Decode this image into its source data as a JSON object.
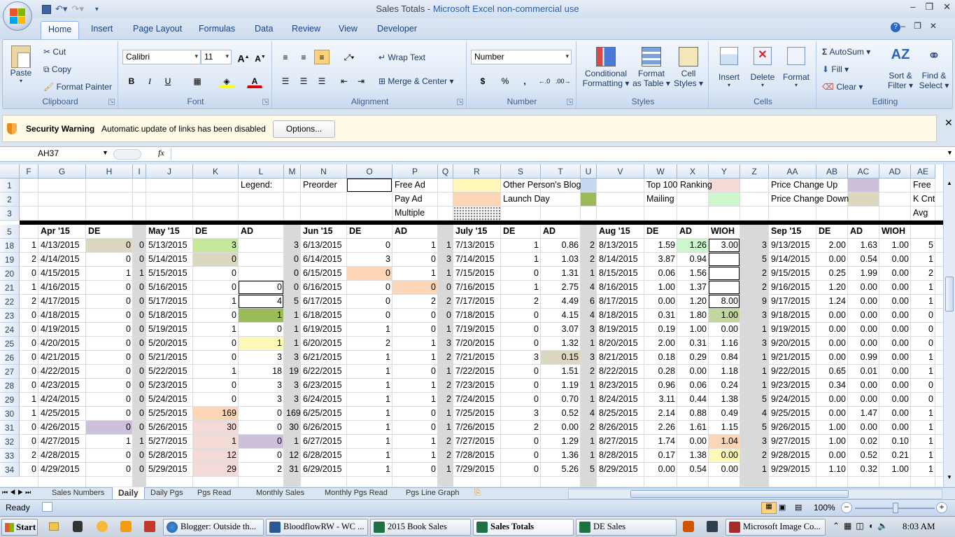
{
  "window": {
    "title_doc": "Sales Totals",
    "title_sep": "  -  ",
    "title_app": "Microsoft Excel non-commercial use"
  },
  "ribbon": {
    "tabs": [
      "Home",
      "Insert",
      "Page Layout",
      "Formulas",
      "Data",
      "Review",
      "View",
      "Developer"
    ],
    "clipboard": {
      "paste": "Paste",
      "cut": "Cut",
      "copy": "Copy",
      "format_painter": "Format Painter",
      "label": "Clipboard"
    },
    "font": {
      "name": "Calibri",
      "size": "11",
      "label": "Font",
      "bold": "B",
      "italic": "I",
      "underline": "U"
    },
    "alignment": {
      "wrap": "Wrap Text",
      "merge": "Merge & Center",
      "label": "Alignment"
    },
    "number": {
      "format": "Number",
      "label": "Number",
      "currency": "$",
      "percent": "%",
      "comma": ","
    },
    "styles": {
      "conditional": "Conditional",
      "conditional2": "Formatting",
      "format_table": "Format",
      "format_table2": "as Table",
      "cell_styles": "Cell",
      "cell_styles2": "Styles",
      "label": "Styles"
    },
    "cells": {
      "insert": "Insert",
      "delete": "Delete",
      "format": "Format",
      "label": "Cells"
    },
    "editing": {
      "autosum": "AutoSum",
      "fill": "Fill",
      "clear": "Clear",
      "sort": "Sort &",
      "sort2": "Filter",
      "find": "Find &",
      "find2": "Select",
      "label": "Editing"
    }
  },
  "security": {
    "title": "Security Warning",
    "message": "Automatic update of links has been disabled",
    "options": "Options..."
  },
  "formula_bar": {
    "name_box": "AH37",
    "fx": "fx",
    "formula": ""
  },
  "columns": [
    "F",
    "G",
    "H",
    "I",
    "J",
    "K",
    "L",
    "M",
    "N",
    "O",
    "P",
    "Q",
    "R",
    "S",
    "T",
    "U",
    "V",
    "W",
    "X",
    "Y",
    "Z",
    "AA",
    "AB",
    "AC",
    "AD",
    "AE"
  ],
  "rows": [
    "1",
    "2",
    "3",
    "5",
    "18",
    "19",
    "20",
    "21",
    "22",
    "23",
    "24",
    "25",
    "26",
    "27",
    "28",
    "29",
    "30",
    "31",
    "32",
    "33",
    "34"
  ],
  "legend": {
    "legend": "Legend:",
    "preorder": "Preorder",
    "free_ad": "Free Ad",
    "pay_ad": "Pay Ad",
    "multiple": "Multiple",
    "other_blog": "Other Person's Blog",
    "launch_day": "Launch Day",
    "top100": "Top 100 Ranking",
    "mailing": "Mailing",
    "price_up": "Price Change Up",
    "price_down": "Price Change Down",
    "free": "Free",
    "kcnt": "K Cnt",
    "avg": "Avg"
  },
  "headers": {
    "apr": "Apr '15",
    "may": "May '15",
    "jun": "Jun '15",
    "jul": "July '15",
    "aug": "Aug '15",
    "sep": "Sep '15",
    "de": "DE",
    "ad": "AD",
    "wioh": "WIOH"
  },
  "table": [
    [
      "1",
      "4/13/2015",
      "0",
      "0",
      "5/13/2015",
      "3",
      "",
      "3",
      "6/13/2015",
      "0",
      "1",
      "1",
      "7/13/2015",
      "1",
      "0.86",
      "2",
      "8/13/2015",
      "1.59",
      "1.26",
      "3.00",
      "3",
      "9/13/2015",
      "2.00",
      "1.63",
      "1.00",
      "5"
    ],
    [
      "2",
      "4/14/2015",
      "0",
      "0",
      "5/14/2015",
      "0",
      "",
      "0",
      "6/14/2015",
      "3",
      "0",
      "3",
      "7/14/2015",
      "1",
      "1.03",
      "2",
      "8/14/2015",
      "3.87",
      "0.94",
      "",
      "5",
      "9/14/2015",
      "0.00",
      "0.54",
      "0.00",
      "1"
    ],
    [
      "0",
      "4/15/2015",
      "1",
      "1",
      "5/15/2015",
      "0",
      "",
      "0",
      "6/15/2015",
      "0",
      "1",
      "1",
      "7/15/2015",
      "0",
      "1.31",
      "1",
      "8/15/2015",
      "0.06",
      "1.56",
      "",
      "2",
      "9/15/2015",
      "0.25",
      "1.99",
      "0.00",
      "2"
    ],
    [
      "1",
      "4/16/2015",
      "0",
      "0",
      "5/16/2015",
      "0",
      "0",
      "0",
      "6/16/2015",
      "0",
      "0",
      "0",
      "7/16/2015",
      "1",
      "2.75",
      "4",
      "8/16/2015",
      "1.00",
      "1.37",
      "",
      "2",
      "9/16/2015",
      "1.20",
      "0.00",
      "0.00",
      "1"
    ],
    [
      "2",
      "4/17/2015",
      "0",
      "0",
      "5/17/2015",
      "1",
      "4",
      "5",
      "6/17/2015",
      "0",
      "2",
      "2",
      "7/17/2015",
      "2",
      "4.49",
      "6",
      "8/17/2015",
      "0.00",
      "1.20",
      "8.00",
      "9",
      "9/17/2015",
      "1.24",
      "0.00",
      "0.00",
      "1"
    ],
    [
      "0",
      "4/18/2015",
      "0",
      "0",
      "5/18/2015",
      "0",
      "1",
      "1",
      "6/18/2015",
      "0",
      "0",
      "0",
      "7/18/2015",
      "0",
      "4.15",
      "4",
      "8/18/2015",
      "0.31",
      "1.80",
      "1.00",
      "3",
      "9/18/2015",
      "0.00",
      "0.00",
      "0.00",
      "0"
    ],
    [
      "0",
      "4/19/2015",
      "0",
      "0",
      "5/19/2015",
      "1",
      "0",
      "1",
      "6/19/2015",
      "1",
      "0",
      "1",
      "7/19/2015",
      "0",
      "3.07",
      "3",
      "8/19/2015",
      "0.19",
      "1.00",
      "0.00",
      "1",
      "9/19/2015",
      "0.00",
      "0.00",
      "0.00",
      "0"
    ],
    [
      "0",
      "4/20/2015",
      "0",
      "0",
      "5/20/2015",
      "0",
      "1",
      "1",
      "6/20/2015",
      "2",
      "1",
      "3",
      "7/20/2015",
      "0",
      "1.32",
      "1",
      "8/20/2015",
      "2.00",
      "0.31",
      "1.16",
      "3",
      "9/20/2015",
      "0.00",
      "0.00",
      "0.00",
      "0"
    ],
    [
      "0",
      "4/21/2015",
      "0",
      "0",
      "5/21/2015",
      "0",
      "3",
      "3",
      "6/21/2015",
      "1",
      "1",
      "2",
      "7/21/2015",
      "3",
      "0.15",
      "3",
      "8/21/2015",
      "0.18",
      "0.29",
      "0.84",
      "1",
      "9/21/2015",
      "0.00",
      "0.99",
      "0.00",
      "1"
    ],
    [
      "0",
      "4/22/2015",
      "0",
      "0",
      "5/22/2015",
      "1",
      "18",
      "19",
      "6/22/2015",
      "1",
      "0",
      "1",
      "7/22/2015",
      "0",
      "1.51",
      "2",
      "8/22/2015",
      "0.28",
      "0.00",
      "1.18",
      "1",
      "9/22/2015",
      "0.65",
      "0.01",
      "0.00",
      "1"
    ],
    [
      "0",
      "4/23/2015",
      "0",
      "0",
      "5/23/2015",
      "0",
      "3",
      "3",
      "6/23/2015",
      "1",
      "1",
      "2",
      "7/23/2015",
      "0",
      "1.19",
      "1",
      "8/23/2015",
      "0.96",
      "0.06",
      "0.24",
      "1",
      "9/23/2015",
      "0.34",
      "0.00",
      "0.00",
      "0"
    ],
    [
      "1",
      "4/24/2015",
      "0",
      "0",
      "5/24/2015",
      "0",
      "3",
      "3",
      "6/24/2015",
      "1",
      "1",
      "2",
      "7/24/2015",
      "0",
      "0.70",
      "1",
      "8/24/2015",
      "3.11",
      "0.44",
      "1.38",
      "5",
      "9/24/2015",
      "0.00",
      "0.00",
      "0.00",
      "0"
    ],
    [
      "1",
      "4/25/2015",
      "0",
      "0",
      "5/25/2015",
      "169",
      "0",
      "169",
      "6/25/2015",
      "1",
      "0",
      "1",
      "7/25/2015",
      "3",
      "0.52",
      "4",
      "8/25/2015",
      "2.14",
      "0.88",
      "0.49",
      "4",
      "9/25/2015",
      "0.00",
      "1.47",
      "0.00",
      "1"
    ],
    [
      "0",
      "4/26/2015",
      "0",
      "0",
      "5/26/2015",
      "30",
      "0",
      "30",
      "6/26/2015",
      "1",
      "0",
      "1",
      "7/26/2015",
      "2",
      "0.00",
      "2",
      "8/26/2015",
      "2.26",
      "1.61",
      "1.15",
      "5",
      "9/26/2015",
      "1.00",
      "0.00",
      "0.00",
      "1"
    ],
    [
      "0",
      "4/27/2015",
      "1",
      "1",
      "5/27/2015",
      "1",
      "0",
      "1",
      "6/27/2015",
      "1",
      "1",
      "2",
      "7/27/2015",
      "0",
      "1.29",
      "1",
      "8/27/2015",
      "1.74",
      "0.00",
      "1.04",
      "3",
      "9/27/2015",
      "1.00",
      "0.02",
      "0.10",
      "1"
    ],
    [
      "2",
      "4/28/2015",
      "0",
      "0",
      "5/28/2015",
      "12",
      "0",
      "12",
      "6/28/2015",
      "1",
      "1",
      "2",
      "7/28/2015",
      "0",
      "1.36",
      "1",
      "8/28/2015",
      "0.17",
      "1.38",
      "0.00",
      "2",
      "9/28/2015",
      "0.00",
      "0.52",
      "0.21",
      "1"
    ],
    [
      "0",
      "4/29/2015",
      "0",
      "0",
      "5/29/2015",
      "29",
      "2",
      "31",
      "6/29/2015",
      "1",
      "0",
      "1",
      "7/29/2015",
      "0",
      "5.26",
      "5",
      "8/29/2015",
      "0.00",
      "0.54",
      "0.00",
      "1",
      "9/29/2015",
      "1.10",
      "0.32",
      "1.00",
      "1"
    ]
  ],
  "sheet_tabs": [
    "Sales Numbers",
    "Daily",
    "Daily Pgs",
    "Pgs Read",
    "Monthly Sales",
    "Monthly Pgs Read",
    "Pgs Line Graph"
  ],
  "status": {
    "ready": "Ready",
    "zoom": "100%"
  },
  "taskbar": {
    "start": "Start",
    "items": [
      "Blogger: Outside th...",
      "BloodflowRW - WC ...",
      "2015 Book Sales",
      "Sales Totals",
      "DE Sales",
      "Microsoft Image Co..."
    ],
    "clock": "8:03 AM"
  },
  "colors": {
    "tan": "#dcd8c0",
    "green": "#c5e89a",
    "salmon": "#fbd5b5",
    "pink": "#f3dad6",
    "lavender": "#ccc0da",
    "yellow": "#fff7b8",
    "olive": "#c3d69b",
    "mint": "#ccf7cc",
    "blue": "#c5d9f1"
  }
}
